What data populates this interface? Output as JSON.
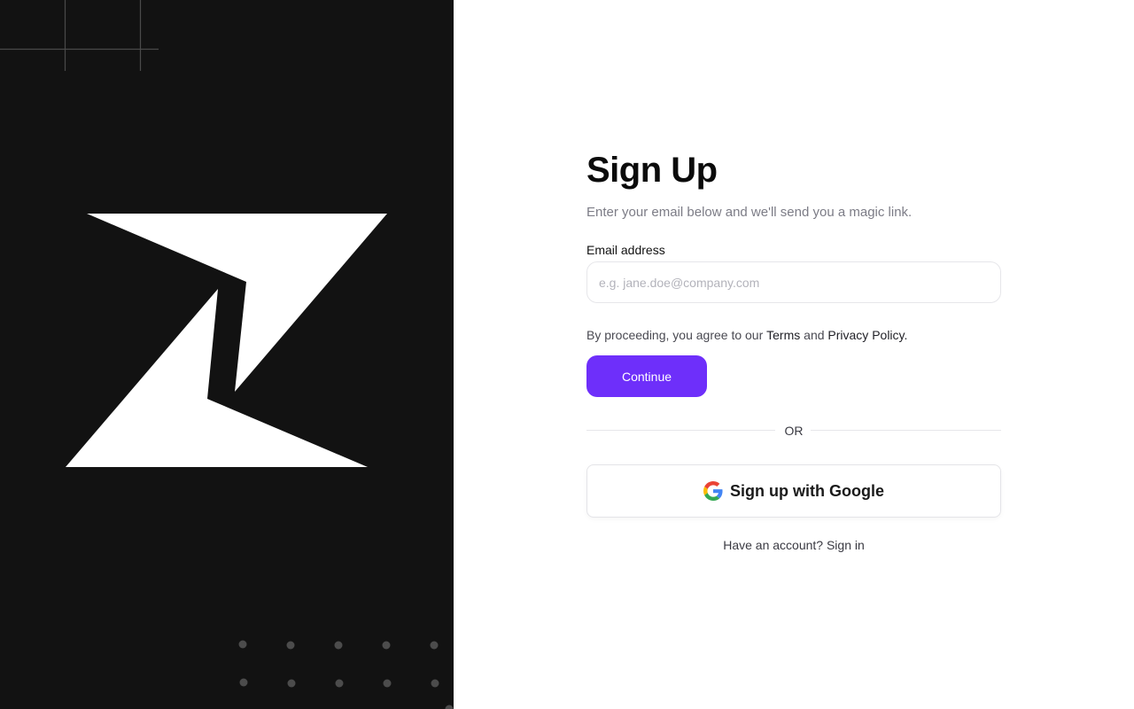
{
  "form": {
    "title": "Sign Up",
    "subtitle": "Enter your email below and we'll send you a magic link.",
    "email_label": "Email address",
    "email_placeholder": "e.g. jane.doe@company.com",
    "email_value": "",
    "terms_prefix": "By proceeding, you agree to our ",
    "terms_link": "Terms",
    "terms_middle": " and ",
    "privacy_link": "Privacy Policy.",
    "continue_label": "Continue",
    "divider_label": "OR",
    "google_label": "Sign up with Google",
    "have_account_text": "Have an account?",
    "signin_link": "Sign in"
  },
  "brand": {
    "logo_icon": "zed-logo-icon",
    "panel_color": "#121212",
    "logo_color": "#ffffff"
  },
  "colors": {
    "accent": "#6e2ffa",
    "text_primary": "#0b0b0b",
    "text_muted": "#7c7c86",
    "border": "#e6e6ea"
  }
}
